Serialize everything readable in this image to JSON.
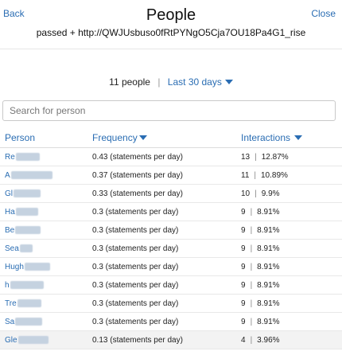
{
  "header": {
    "back_label": "Back",
    "title": "People",
    "subtitle": "passed + http://QWJUsbuso0fRtPYNgO5Cja7OU18Pa4G1_rise",
    "close_label": "Close"
  },
  "filter": {
    "count_label": "11 people",
    "separator": "|",
    "range_label": "Last 30 days"
  },
  "search": {
    "placeholder": "Search for person"
  },
  "table": {
    "columns": [
      "Person",
      "Frequency",
      "Interactions"
    ],
    "rows": [
      {
        "person": "Re",
        "frequency": "0.43 (statements per day)",
        "interactions": "13",
        "percent": "12.87%"
      },
      {
        "person": "A",
        "frequency": "0.37 (statements per day)",
        "interactions": "11",
        "percent": "10.89%"
      },
      {
        "person": "Gl",
        "frequency": "0.33 (statements per day)",
        "interactions": "10",
        "percent": "9.9%"
      },
      {
        "person": "Ha",
        "frequency": "0.3 (statements per day)",
        "interactions": "9",
        "percent": "8.91%"
      },
      {
        "person": "Be",
        "frequency": "0.3 (statements per day)",
        "interactions": "9",
        "percent": "8.91%"
      },
      {
        "person": "Sea",
        "frequency": "0.3 (statements per day)",
        "interactions": "9",
        "percent": "8.91%"
      },
      {
        "person": "Hugh",
        "frequency": "0.3 (statements per day)",
        "interactions": "9",
        "percent": "8.91%"
      },
      {
        "person": "h",
        "frequency": "0.3 (statements per day)",
        "interactions": "9",
        "percent": "8.91%"
      },
      {
        "person": "Tre",
        "frequency": "0.3 (statements per day)",
        "interactions": "9",
        "percent": "8.91%"
      },
      {
        "person": "Sa",
        "frequency": "0.3 (statements per day)",
        "interactions": "9",
        "percent": "8.91%"
      },
      {
        "person": "Gle",
        "frequency": "0.13 (statements per day)",
        "interactions": "4",
        "percent": "3.96%"
      }
    ]
  },
  "colors": {
    "accent": "#2a6db3",
    "row_highlight": "#f3f3f3"
  }
}
